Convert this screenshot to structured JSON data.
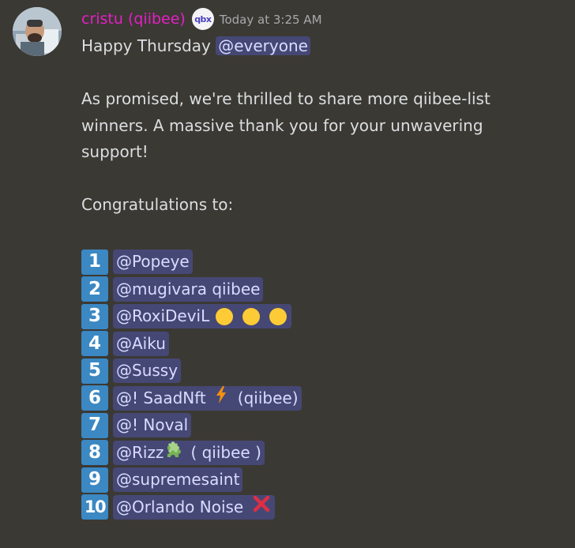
{
  "author": {
    "name": "cristu (qiibee)",
    "role_badge_text": "qbx",
    "timestamp": "Today at 3:25 AM",
    "name_color": "#e61ec8"
  },
  "message": {
    "greeting": "Happy Thursday ",
    "greeting_mention": "@everyone",
    "paragraph_lines": [
      "As promised, we're thrilled to share more qiibee-list",
      "winners. A massive thank you for your unwavering",
      "support!"
    ],
    "congrats": "Congratulations to:"
  },
  "winners": [
    {
      "number": "1",
      "mention": "@Popeye",
      "suffix": ""
    },
    {
      "number": "2",
      "mention": "@mugivara qiibee",
      "suffix": ""
    },
    {
      "number": "3",
      "mention": "@RoxiDeviL",
      "suffix": "",
      "icon": "yellow-circles-icon"
    },
    {
      "number": "4",
      "mention": "@Aiku",
      "suffix": ""
    },
    {
      "number": "5",
      "mention": "@Sussy",
      "suffix": ""
    },
    {
      "number": "6",
      "mention": "@! SaadNft",
      "suffix": "(qiibee)",
      "icon": "lightning-icon"
    },
    {
      "number": "7",
      "mention": "@! Noval",
      "suffix": ""
    },
    {
      "number": "8",
      "mention": "@Rizz",
      "suffix": "( qiibee )",
      "icon": "puzzle-icon"
    },
    {
      "number": "9",
      "mention": "@supremesaint",
      "suffix": ""
    },
    {
      "number": "10",
      "mention": "@Orlando Noise",
      "suffix": "",
      "icon": "cross-mark-icon"
    }
  ],
  "colors": {
    "background": "#3b3933",
    "mention_bg": "rgba(88,101,242,0.35)",
    "keycap": "#3b88c3"
  }
}
